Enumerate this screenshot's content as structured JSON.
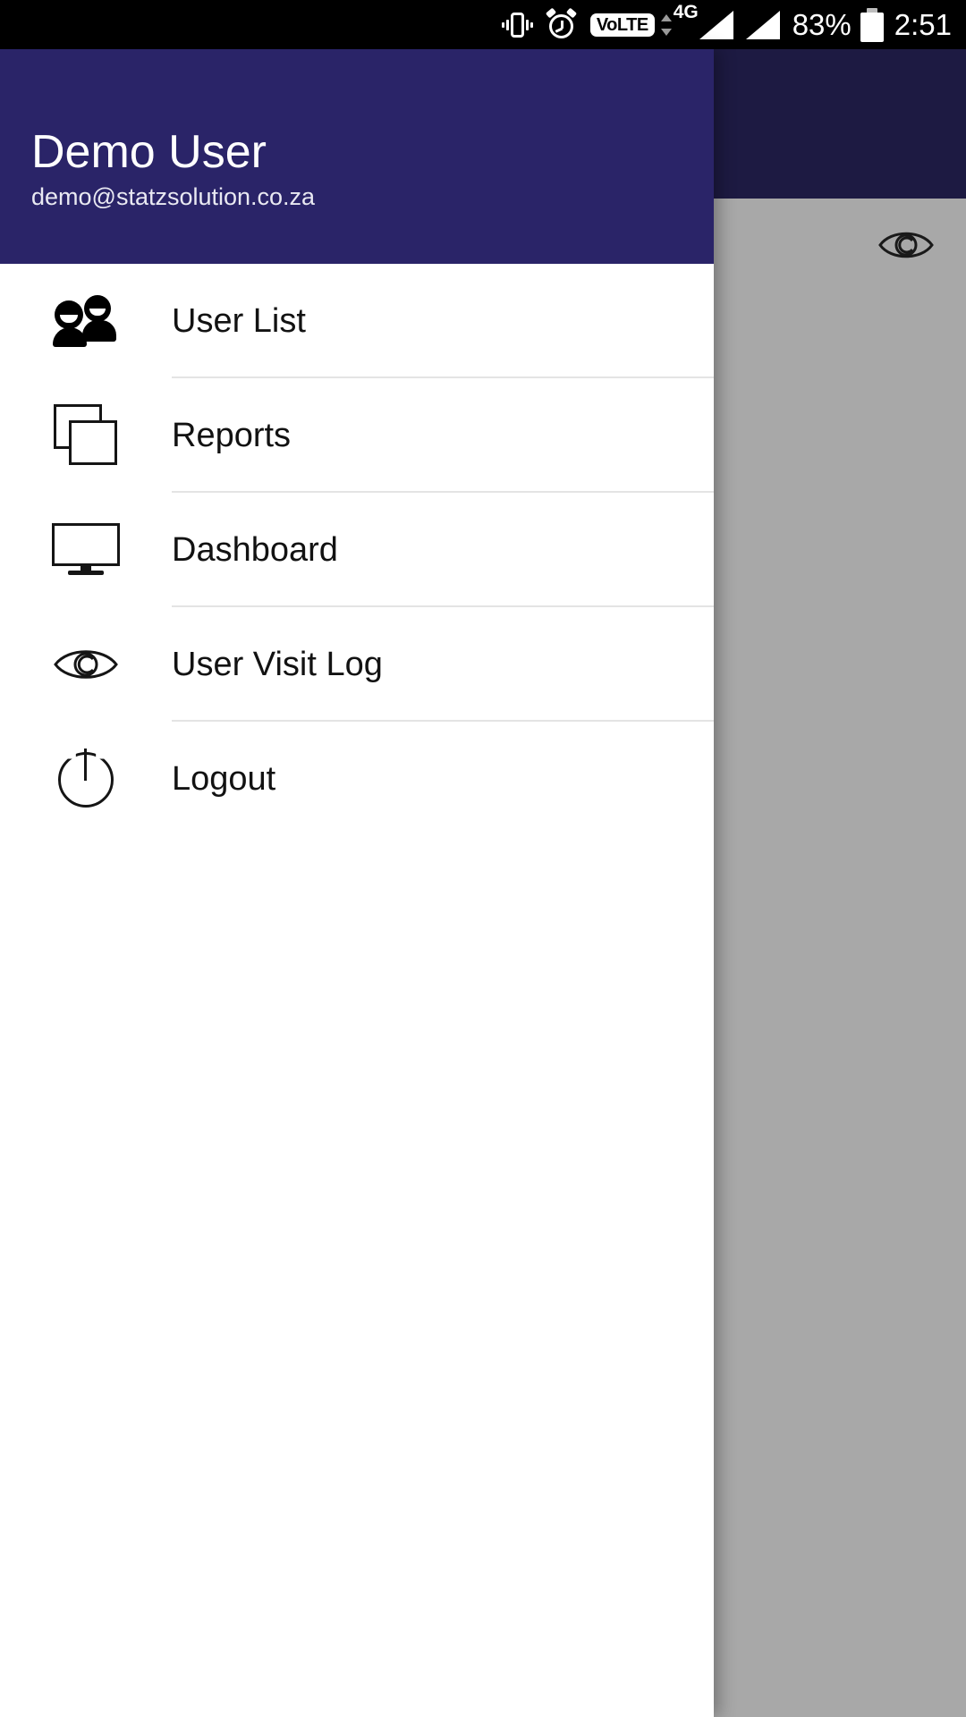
{
  "status_bar": {
    "vibrate_icon": "vibrate-icon",
    "alarm_icon": "alarm-icon",
    "volte_label": "VoLTE",
    "data_arrows_icon": "data-transfer-arrows-icon",
    "network_type": "4G",
    "signal_icon_1": "signal-bars-icon",
    "signal_icon_2": "signal-bars-icon",
    "battery_percent": "83%",
    "battery_icon": "battery-icon",
    "clock": "2:51"
  },
  "drawer": {
    "header": {
      "username": "Demo User",
      "email": "demo@statzsolution.co.za",
      "background_color": "#2a2468"
    },
    "items": [
      {
        "label": "User List",
        "icon": "people-icon"
      },
      {
        "label": "Reports",
        "icon": "copy-icon"
      },
      {
        "label": "Dashboard",
        "icon": "monitor-icon"
      },
      {
        "label": "User Visit Log",
        "icon": "eye-icon"
      },
      {
        "label": "Logout",
        "icon": "power-icon"
      }
    ]
  },
  "background": {
    "appbar_color": "#1d1a42",
    "body_color": "#a8a8a8",
    "eye_icon": "eye-icon"
  }
}
